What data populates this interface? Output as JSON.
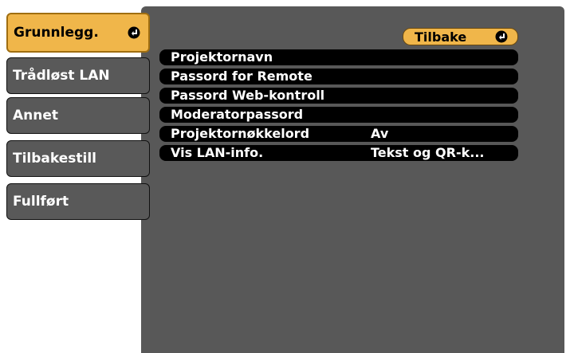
{
  "sidebar": {
    "items": [
      {
        "label": "Grunnlegg."
      },
      {
        "label": "Trådløst LAN"
      },
      {
        "label": "Annet"
      },
      {
        "label": "Tilbakestill"
      },
      {
        "label": "Fullført"
      }
    ]
  },
  "header": {
    "back_label": "Tilbake"
  },
  "settings": {
    "rows": [
      {
        "label": "Projektornavn",
        "value": ""
      },
      {
        "label": "Passord for Remote",
        "value": ""
      },
      {
        "label": "Passord Web-kontroll",
        "value": ""
      },
      {
        "label": "Moderatorpassord",
        "value": ""
      },
      {
        "label": "Projektornøkkelord",
        "value": "Av"
      },
      {
        "label": "Vis LAN-info.",
        "value": "Tekst og QR-k..."
      }
    ]
  },
  "colors": {
    "accent": "#f0b64a",
    "panel": "#585858",
    "row": "#000000",
    "text": "#ffffff"
  },
  "icons": {
    "enter": "enter-return-icon"
  }
}
